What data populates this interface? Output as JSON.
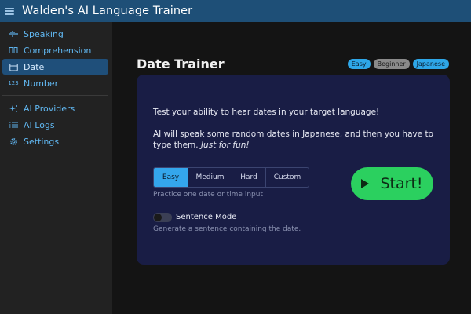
{
  "app": {
    "title": "Walden's AI Language Trainer"
  },
  "sidebar": {
    "items": [
      {
        "label": "Speaking",
        "icon": "waveform-icon"
      },
      {
        "label": "Comprehension",
        "icon": "book-icon"
      },
      {
        "label": "Date",
        "icon": "calendar-icon",
        "active": true
      },
      {
        "label": "Number",
        "icon": "numbers-icon",
        "glyph": "123"
      },
      {
        "label": "AI Providers",
        "icon": "sparkles-icon"
      },
      {
        "label": "AI Logs",
        "icon": "list-icon"
      },
      {
        "label": "Settings",
        "icon": "gear-icon"
      }
    ]
  },
  "page": {
    "title": "Date Trainer",
    "badges": [
      "Easy",
      "Beginner",
      "Japanese"
    ]
  },
  "card": {
    "intro": "Test your ability to hear dates in your target language!",
    "desc_line1": "AI will speak some random dates in Japanese, and then you have to",
    "desc_line2": "type them.",
    "desc_emph": "Just for fun!",
    "difficulty": {
      "options": [
        "Easy",
        "Medium",
        "Hard",
        "Custom"
      ],
      "selected": "Easy",
      "hint": "Practice one date or time input"
    },
    "sentence_mode": {
      "label": "Sentence Mode",
      "enabled": false,
      "hint": "Generate a sentence containing the date."
    },
    "start_label": "Start!"
  },
  "colors": {
    "titlebar": "#1e4f77",
    "accent": "#34a6ec",
    "card": "#191d45",
    "start": "#2bd05f"
  }
}
